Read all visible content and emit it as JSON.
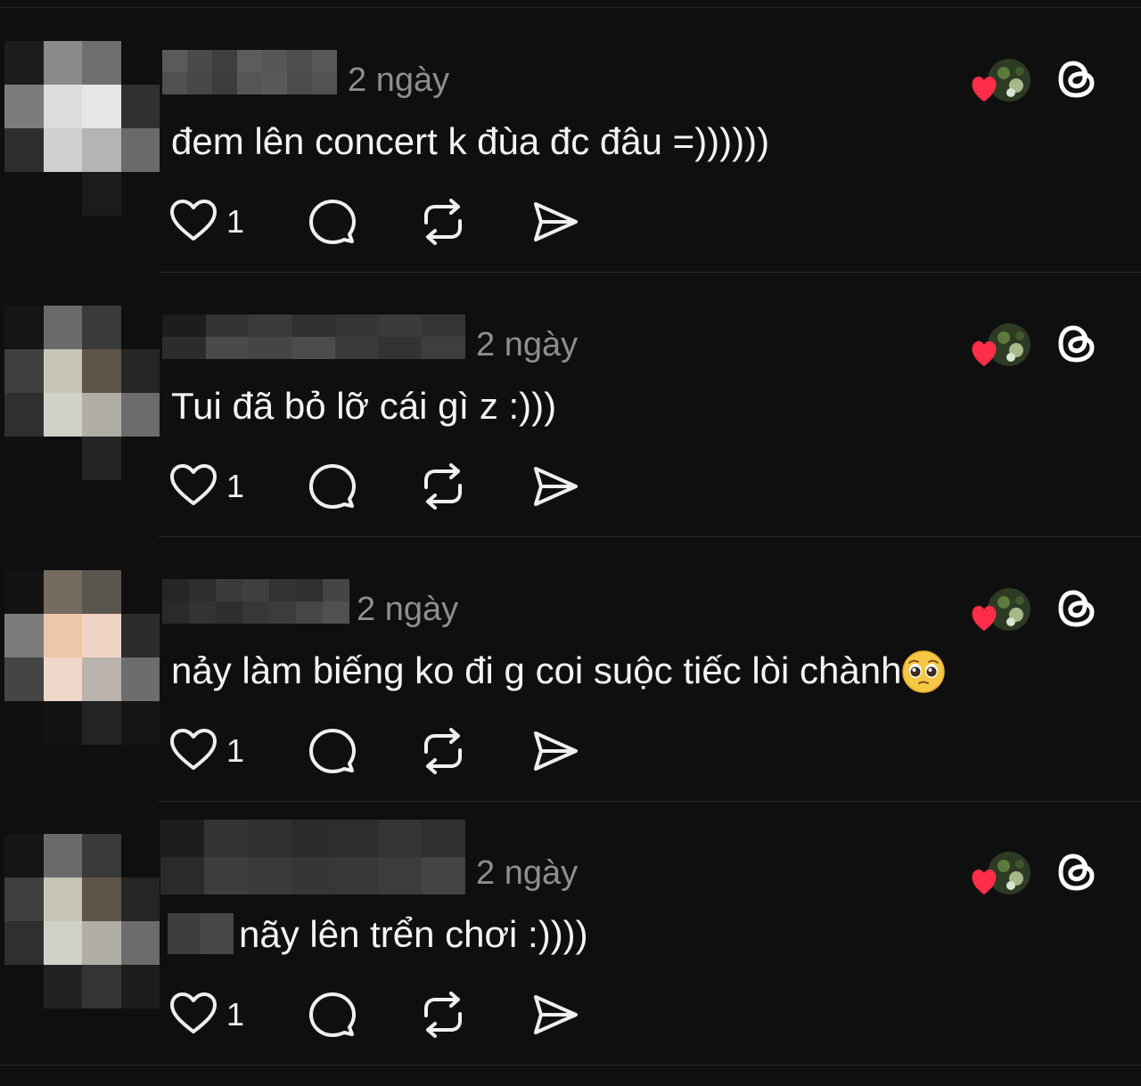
{
  "colors": {
    "background": "#0f0f10",
    "text": "#f5f5f5",
    "muted": "#8e8e8e",
    "divider": "#2a2a2a",
    "heart": "#ff2d48"
  },
  "posts": [
    {
      "time": "2 ngày",
      "text": "đem lên concert k đùa đc đâu =))))))",
      "like_count": "1",
      "icons": [
        "heart-icon",
        "comment-icon",
        "repost-icon",
        "share-icon"
      ]
    },
    {
      "time": "2 ngày",
      "text": "Tui đã bỏ lỡ cái gì z :)))",
      "like_count": "1",
      "icons": [
        "heart-icon",
        "comment-icon",
        "repost-icon",
        "share-icon"
      ]
    },
    {
      "time": "2 ngày",
      "text": "nảy làm biếng ko đi g coi suộc tiếc lòi chành",
      "emoji": "pleading-face-emoji",
      "like_count": "1",
      "icons": [
        "heart-icon",
        "comment-icon",
        "repost-icon",
        "share-icon"
      ]
    },
    {
      "time": "2 ngày",
      "text": "nãy lên trển chơi :))))",
      "like_count": "1",
      "icons": [
        "heart-icon",
        "comment-icon",
        "repost-icon",
        "share-icon"
      ]
    }
  ]
}
